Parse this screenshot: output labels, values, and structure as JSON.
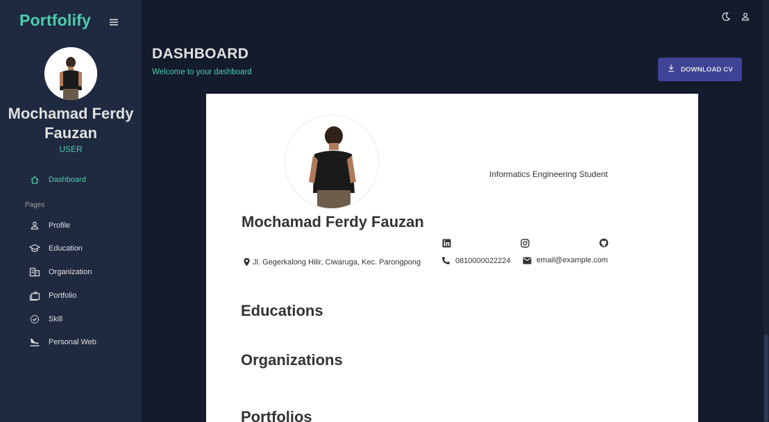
{
  "app": {
    "brand": "Portfolify"
  },
  "sidebar": {
    "user_name": "Mochamad Ferdy Fauzan",
    "user_role": "USER",
    "section_label": "Pages",
    "items": [
      {
        "label": "Dashboard",
        "icon": "home-icon"
      },
      {
        "label": "Profile",
        "icon": "person-icon"
      },
      {
        "label": "Education",
        "icon": "school-icon"
      },
      {
        "label": "Organization",
        "icon": "building-icon"
      },
      {
        "label": "Portfolio",
        "icon": "briefcase-icon"
      },
      {
        "label": "Skill",
        "icon": "verified-icon"
      },
      {
        "label": "Personal Web",
        "icon": "flight-land-icon"
      }
    ]
  },
  "header": {
    "title": "DASHBOARD",
    "subtitle": "Welcome to your dashboard",
    "download_label": "DOWNLOAD CV"
  },
  "cv": {
    "name": "Mochamad Ferdy Fauzan",
    "tagline": "Informatics Engineering Student",
    "address": "Jl. Gegerkalong Hilir, Ciwaruga, Kec. Parongpong",
    "phone": "0810000022224",
    "email": "email@example.com",
    "sections": [
      "Educations",
      "Organizations",
      "Portfolios"
    ]
  },
  "colors": {
    "accent": "#4cceac",
    "button": "#3e4396",
    "bg": "#141b2d",
    "sidebar": "#1f2a40"
  }
}
